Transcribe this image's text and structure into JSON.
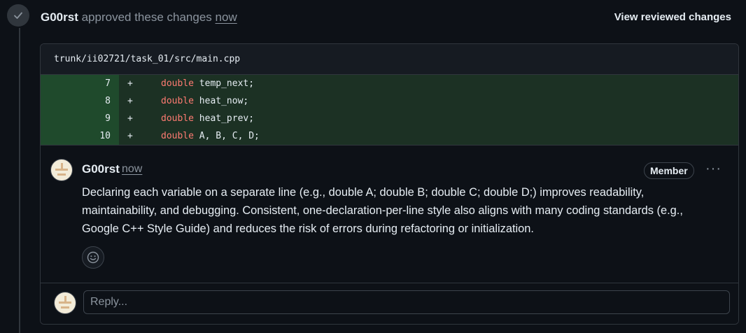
{
  "review": {
    "user": "G00rst",
    "action": " approved these changes ",
    "time": "now",
    "view_button": "View reviewed changes"
  },
  "file": {
    "path": "trunk/ii02721/task_01/src/main.cpp",
    "lines": [
      {
        "num": "7",
        "sign": "+",
        "keyword": "double",
        "rest": " temp_next;"
      },
      {
        "num": "8",
        "sign": "+",
        "keyword": "double",
        "rest": " heat_now;"
      },
      {
        "num": "9",
        "sign": "+",
        "keyword": "double",
        "rest": " heat_prev;"
      },
      {
        "num": "10",
        "sign": "+",
        "keyword": "double",
        "rest": " A, B, C, D;"
      }
    ]
  },
  "comment": {
    "user": "G00rst",
    "time": "now",
    "role": "Member",
    "more": "···",
    "body": "Declaring each variable on a separate line (e.g., double A; double B; double C; double D;) improves readability, maintainability, and debugging. Consistent, one-declaration-per-line style also aligns with many coding standards (e.g., Google C++ Style Guide) and reduces the risk of errors during refactoring or initialization."
  },
  "reply": {
    "placeholder": "Reply..."
  },
  "colors": {
    "accent_add": "#1c3124",
    "accent_add_gutter": "#1f4a2c",
    "keyword": "#ff7b72",
    "background": "#0d1117"
  }
}
